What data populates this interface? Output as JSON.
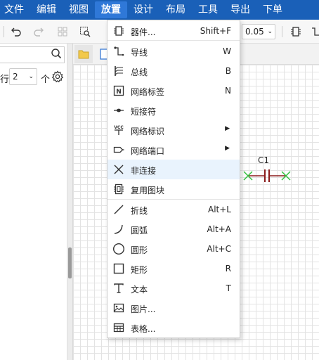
{
  "menubar": {
    "items": [
      "文件",
      "编辑",
      "视图",
      "放置",
      "设计",
      "布局",
      "工具",
      "导出",
      "下单"
    ],
    "active_index": 3
  },
  "toolbar": {
    "zoom_value": "0.05"
  },
  "left_panel": {
    "row_label": "行",
    "row_value": "2",
    "row_unit": "个"
  },
  "canvas": {
    "component_label": "C1"
  },
  "dropdown": {
    "items": [
      {
        "label": "器件...",
        "shortcut": "Shift+F",
        "icon": "component-icon"
      },
      {
        "label": "导线",
        "shortcut": "W",
        "icon": "wire-icon"
      },
      {
        "label": "总线",
        "shortcut": "B",
        "icon": "bus-icon"
      },
      {
        "label": "网络标签",
        "shortcut": "N",
        "icon": "net-label-icon"
      },
      {
        "label": "短接符",
        "shortcut": "",
        "icon": "short-icon"
      },
      {
        "label": "网络标识",
        "shortcut": "",
        "icon": "net-flag-icon",
        "submenu": true
      },
      {
        "label": "网络端口",
        "shortcut": "",
        "icon": "net-port-icon",
        "submenu": true
      },
      {
        "label": "非连接",
        "shortcut": "",
        "icon": "no-connect-icon",
        "highlighted": true
      },
      {
        "label": "复用图块",
        "shortcut": "",
        "icon": "reuse-block-icon"
      },
      {
        "label": "折线",
        "shortcut": "Alt+L",
        "icon": "polyline-icon"
      },
      {
        "label": "圆弧",
        "shortcut": "Alt+A",
        "icon": "arc-icon"
      },
      {
        "label": "圆形",
        "shortcut": "Alt+C",
        "icon": "circle-icon"
      },
      {
        "label": "矩形",
        "shortcut": "R",
        "icon": "rectangle-icon"
      },
      {
        "label": "文本",
        "shortcut": "T",
        "icon": "text-icon"
      },
      {
        "label": "图片...",
        "shortcut": "",
        "icon": "image-icon"
      },
      {
        "label": "表格...",
        "shortcut": "",
        "icon": "table-icon"
      }
    ]
  },
  "colors": {
    "menubar": "#1a60b8",
    "highlight": "#e9f3fd",
    "capacitor": "#8b1c1c",
    "pin_marker": "#2fbf3a"
  }
}
